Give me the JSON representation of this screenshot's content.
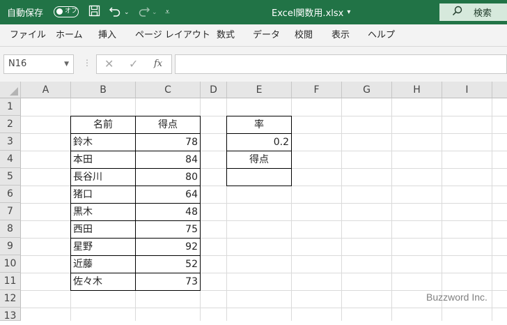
{
  "titlebar": {
    "autosave_label": "自動保存",
    "autosave_state": "オフ",
    "filename": "Excel関数用.xlsx",
    "filename_dropdown": "▾",
    "search_label": "検索"
  },
  "ribbon": {
    "tabs": [
      "ファイル",
      "ホーム",
      "挿入",
      "ページ レイアウト",
      "数式",
      "データ",
      "校閲",
      "表示",
      "ヘルプ"
    ]
  },
  "formula_bar": {
    "name_box": "N16",
    "fx_label": "fx",
    "formula": ""
  },
  "grid": {
    "columns": [
      "A",
      "B",
      "C",
      "D",
      "E",
      "F",
      "G",
      "H",
      "I"
    ],
    "rows": [
      "1",
      "2",
      "3",
      "4",
      "5",
      "6",
      "7",
      "8",
      "9",
      "10",
      "11",
      "12",
      "13"
    ],
    "table_header": [
      "名前",
      "得点"
    ],
    "table_rows": [
      [
        "鈴木",
        "78"
      ],
      [
        "本田",
        "84"
      ],
      [
        "長谷川",
        "80"
      ],
      [
        "猪口",
        "64"
      ],
      [
        "黒木",
        "48"
      ],
      [
        "西田",
        "75"
      ],
      [
        "星野",
        "92"
      ],
      [
        "近藤",
        "52"
      ],
      [
        "佐々木",
        "73"
      ]
    ],
    "rate_label": "率",
    "rate_value": "0.2",
    "score_label": "得点",
    "score_value": ""
  },
  "watermark": "Buzzword Inc.",
  "colors": {
    "title_bar": "#217346",
    "ribbon_bg": "#f3f3f3",
    "header_bg": "#e6e6e6"
  }
}
